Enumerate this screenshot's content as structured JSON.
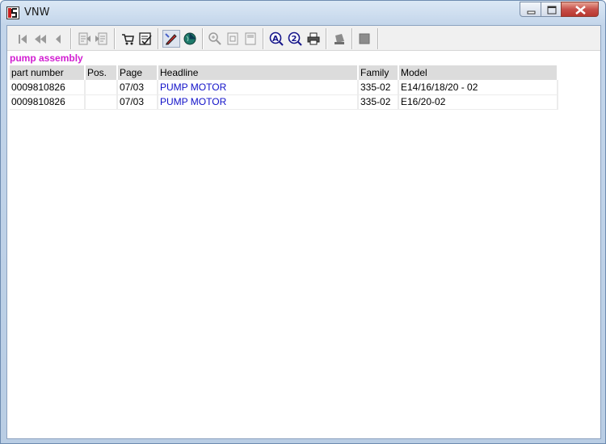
{
  "window": {
    "title": "VNW",
    "app_icon": "vnw-app-icon"
  },
  "caption_buttons": [
    "minimize-icon",
    "maximize-icon",
    "close-icon"
  ],
  "toolbar": {
    "buttons": [
      "first-record-icon",
      "previous-page-icon",
      "previous-record-icon",
      "back-document-icon",
      "forward-document-icon",
      "cart-icon",
      "checklist-icon",
      "highlight-pen-icon",
      "globe-icon",
      "zoom-in-icon",
      "page-icon",
      "page-alt-icon",
      "search-a-icon",
      "search-2-icon",
      "print-icon",
      "stamp-icon",
      "square-icon"
    ]
  },
  "section": {
    "title": "pump assembly",
    "title_color": "#d21ed2",
    "link_color": "#1010c8"
  },
  "table": {
    "headers": [
      "part number",
      "Pos.",
      "Page",
      "Headline",
      "Family",
      "Model"
    ],
    "rows": [
      [
        "0009810826",
        "",
        "07/03",
        "PUMP MOTOR",
        "335-02",
        "E14/16/18/20 - 02"
      ],
      [
        "0009810826",
        "",
        "07/03",
        "PUMP MOTOR",
        "335-02",
        "E16/20-02"
      ]
    ]
  }
}
